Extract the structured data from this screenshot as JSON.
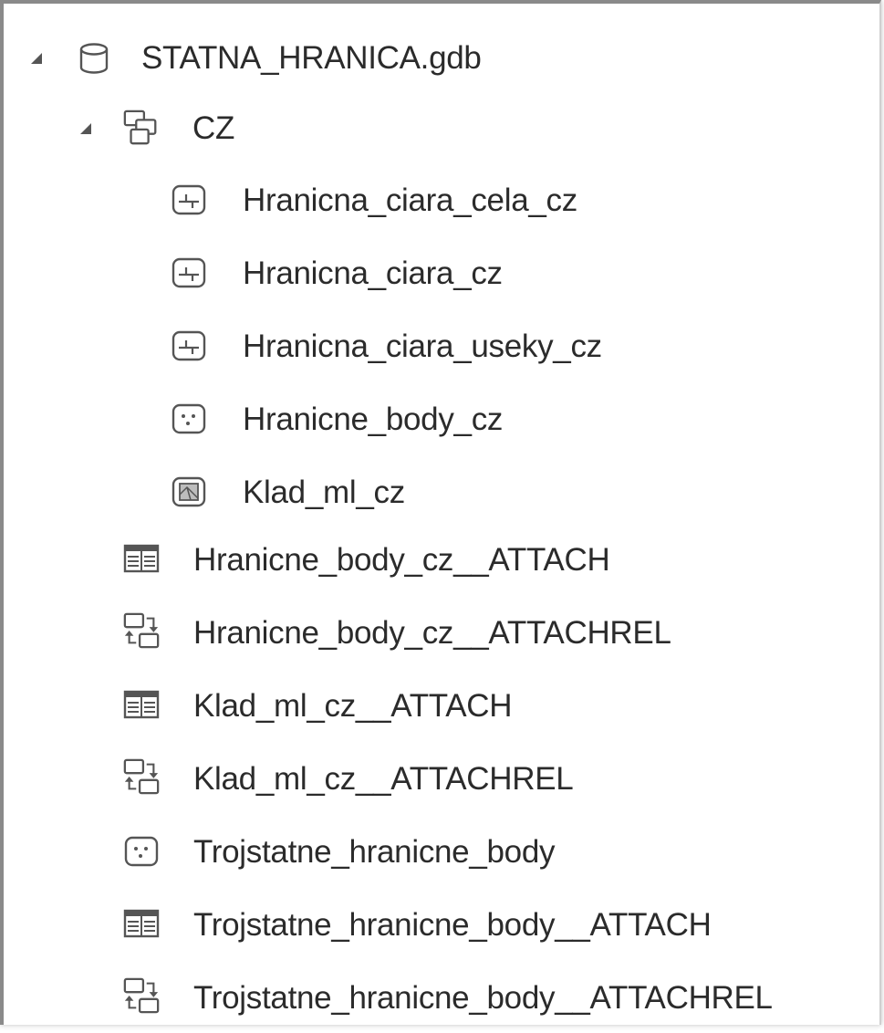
{
  "tree": {
    "root": {
      "label": "STATNA_HRANICA.gdb",
      "icon": "database-icon",
      "expanded": true
    },
    "dataset": {
      "label": "CZ",
      "icon": "feature-dataset-icon",
      "expanded": true
    },
    "dataset_items": [
      {
        "label": "Hranicna_ciara_cela_cz",
        "icon": "line-feature-class-icon"
      },
      {
        "label": "Hranicna_ciara_cz",
        "icon": "line-feature-class-icon"
      },
      {
        "label": "Hranicna_ciara_useky_cz",
        "icon": "line-feature-class-icon"
      },
      {
        "label": "Hranicne_body_cz",
        "icon": "point-feature-class-icon"
      },
      {
        "label": "Klad_ml_cz",
        "icon": "polygon-feature-class-icon"
      }
    ],
    "root_items": [
      {
        "label": "Hranicne_body_cz__ATTACH",
        "icon": "table-icon"
      },
      {
        "label": "Hranicne_body_cz__ATTACHREL",
        "icon": "relationship-class-icon"
      },
      {
        "label": "Klad_ml_cz__ATTACH",
        "icon": "table-icon"
      },
      {
        "label": "Klad_ml_cz__ATTACHREL",
        "icon": "relationship-class-icon"
      },
      {
        "label": "Trojstatne_hranicne_body",
        "icon": "point-feature-class-icon"
      },
      {
        "label": "Trojstatne_hranicne_body__ATTACH",
        "icon": "table-icon"
      },
      {
        "label": "Trojstatne_hranicne_body__ATTACHREL",
        "icon": "relationship-class-icon"
      }
    ]
  }
}
